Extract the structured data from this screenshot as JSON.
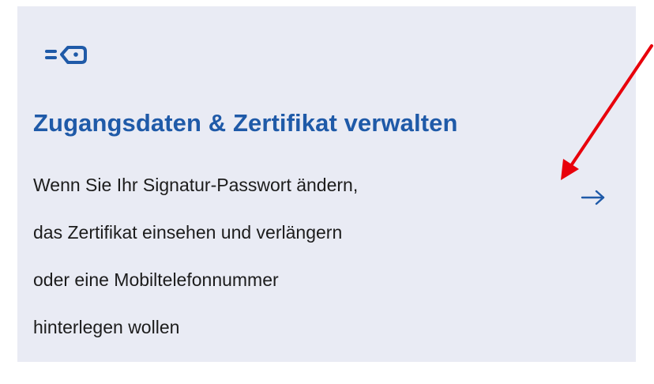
{
  "card": {
    "icon": "key-credential-icon",
    "title": "Zugangsdaten & Zertifikat verwalten",
    "description_lines": [
      "Wenn Sie Ihr Signatur-Passwort ändern,",
      "das Zertifikat einsehen und verlängern",
      "oder eine Mobiltelefonnummer",
      "hinterlegen wollen"
    ],
    "arrow_icon": "arrow-right-icon"
  },
  "annotation": {
    "icon": "red-pointer-arrow",
    "color": "#e8000b"
  },
  "colors": {
    "card_background": "#e9ebf4",
    "accent": "#1f5aa8",
    "text": "#1c1c1c"
  }
}
